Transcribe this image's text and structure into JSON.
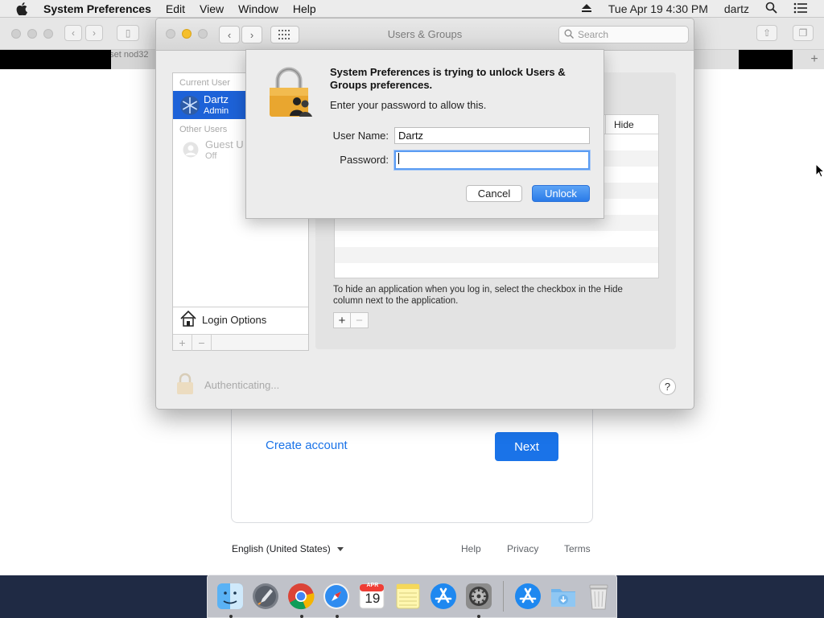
{
  "menubar": {
    "app_name": "System Preferences",
    "menus": [
      "Edit",
      "View",
      "Window",
      "Help"
    ],
    "datetime": "Tue Apr 19  4:30 PM",
    "user": "dartz"
  },
  "browser": {
    "tab_text": "eset nod32",
    "signin": {
      "create_account": "Create account",
      "next": "Next",
      "language": "English (United States)",
      "footer": [
        "Help",
        "Privacy",
        "Terms"
      ]
    }
  },
  "prefs_window": {
    "title": "Users & Groups",
    "search_placeholder": "Search",
    "sidebar": {
      "current_user_header": "Current User",
      "current_user": {
        "name": "Dartz",
        "role": "Admin"
      },
      "other_users_header": "Other Users",
      "guest_user": {
        "name": "Guest U",
        "status": "Off"
      },
      "login_options": "Login Options"
    },
    "items_table": {
      "hide_column": "Hide"
    },
    "hide_hint": "To hide an application when you log in, select the checkbox in the Hide column next to the application.",
    "status": "Authenticating...",
    "help": "?"
  },
  "auth_dialog": {
    "heading": "System Preferences is trying to unlock Users & Groups preferences.",
    "message": "Enter your password to allow this.",
    "username_label": "User Name:",
    "username_value": "Dartz",
    "password_label": "Password:",
    "password_value": "",
    "cancel": "Cancel",
    "unlock": "Unlock"
  },
  "dock": {
    "apps": [
      "finder-icon",
      "launchpad-icon",
      "chrome-icon",
      "safari-icon",
      "calendar-icon",
      "notes-icon",
      "app-store-icon",
      "system-preferences-icon",
      "app-store-downloads-icon",
      "downloads-folder-icon",
      "trash-icon"
    ],
    "calendar": {
      "month": "APR",
      "day": "19"
    }
  },
  "colors": {
    "accent": "#1d62d8",
    "google_blue": "#1a73e8"
  }
}
